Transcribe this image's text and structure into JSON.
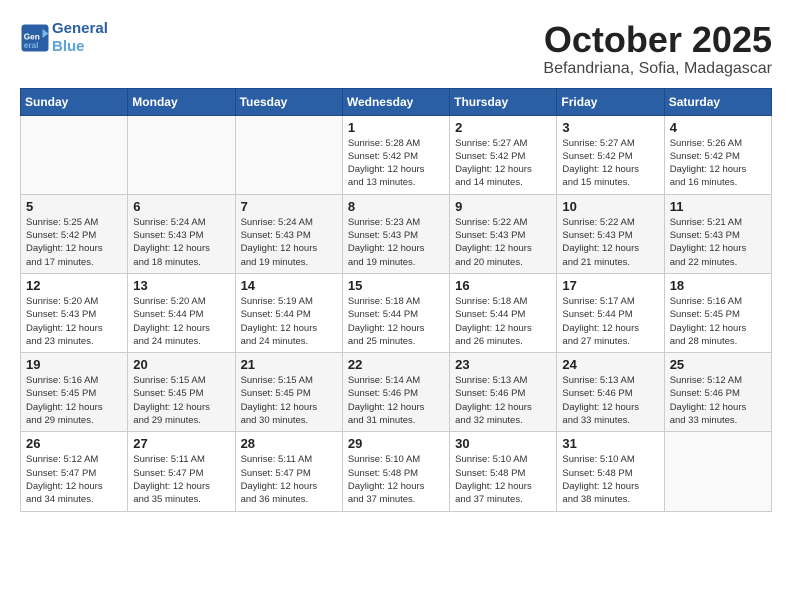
{
  "logo": {
    "text1": "General",
    "text2": "Blue"
  },
  "title": "October 2025",
  "subtitle": "Befandriana, Sofia, Madagascar",
  "days_of_week": [
    "Sunday",
    "Monday",
    "Tuesday",
    "Wednesday",
    "Thursday",
    "Friday",
    "Saturday"
  ],
  "weeks": [
    [
      {
        "day": "",
        "info": ""
      },
      {
        "day": "",
        "info": ""
      },
      {
        "day": "",
        "info": ""
      },
      {
        "day": "1",
        "info": "Sunrise: 5:28 AM\nSunset: 5:42 PM\nDaylight: 12 hours\nand 13 minutes."
      },
      {
        "day": "2",
        "info": "Sunrise: 5:27 AM\nSunset: 5:42 PM\nDaylight: 12 hours\nand 14 minutes."
      },
      {
        "day": "3",
        "info": "Sunrise: 5:27 AM\nSunset: 5:42 PM\nDaylight: 12 hours\nand 15 minutes."
      },
      {
        "day": "4",
        "info": "Sunrise: 5:26 AM\nSunset: 5:42 PM\nDaylight: 12 hours\nand 16 minutes."
      }
    ],
    [
      {
        "day": "5",
        "info": "Sunrise: 5:25 AM\nSunset: 5:42 PM\nDaylight: 12 hours\nand 17 minutes."
      },
      {
        "day": "6",
        "info": "Sunrise: 5:24 AM\nSunset: 5:43 PM\nDaylight: 12 hours\nand 18 minutes."
      },
      {
        "day": "7",
        "info": "Sunrise: 5:24 AM\nSunset: 5:43 PM\nDaylight: 12 hours\nand 19 minutes."
      },
      {
        "day": "8",
        "info": "Sunrise: 5:23 AM\nSunset: 5:43 PM\nDaylight: 12 hours\nand 19 minutes."
      },
      {
        "day": "9",
        "info": "Sunrise: 5:22 AM\nSunset: 5:43 PM\nDaylight: 12 hours\nand 20 minutes."
      },
      {
        "day": "10",
        "info": "Sunrise: 5:22 AM\nSunset: 5:43 PM\nDaylight: 12 hours\nand 21 minutes."
      },
      {
        "day": "11",
        "info": "Sunrise: 5:21 AM\nSunset: 5:43 PM\nDaylight: 12 hours\nand 22 minutes."
      }
    ],
    [
      {
        "day": "12",
        "info": "Sunrise: 5:20 AM\nSunset: 5:43 PM\nDaylight: 12 hours\nand 23 minutes."
      },
      {
        "day": "13",
        "info": "Sunrise: 5:20 AM\nSunset: 5:44 PM\nDaylight: 12 hours\nand 24 minutes."
      },
      {
        "day": "14",
        "info": "Sunrise: 5:19 AM\nSunset: 5:44 PM\nDaylight: 12 hours\nand 24 minutes."
      },
      {
        "day": "15",
        "info": "Sunrise: 5:18 AM\nSunset: 5:44 PM\nDaylight: 12 hours\nand 25 minutes."
      },
      {
        "day": "16",
        "info": "Sunrise: 5:18 AM\nSunset: 5:44 PM\nDaylight: 12 hours\nand 26 minutes."
      },
      {
        "day": "17",
        "info": "Sunrise: 5:17 AM\nSunset: 5:44 PM\nDaylight: 12 hours\nand 27 minutes."
      },
      {
        "day": "18",
        "info": "Sunrise: 5:16 AM\nSunset: 5:45 PM\nDaylight: 12 hours\nand 28 minutes."
      }
    ],
    [
      {
        "day": "19",
        "info": "Sunrise: 5:16 AM\nSunset: 5:45 PM\nDaylight: 12 hours\nand 29 minutes."
      },
      {
        "day": "20",
        "info": "Sunrise: 5:15 AM\nSunset: 5:45 PM\nDaylight: 12 hours\nand 29 minutes."
      },
      {
        "day": "21",
        "info": "Sunrise: 5:15 AM\nSunset: 5:45 PM\nDaylight: 12 hours\nand 30 minutes."
      },
      {
        "day": "22",
        "info": "Sunrise: 5:14 AM\nSunset: 5:46 PM\nDaylight: 12 hours\nand 31 minutes."
      },
      {
        "day": "23",
        "info": "Sunrise: 5:13 AM\nSunset: 5:46 PM\nDaylight: 12 hours\nand 32 minutes."
      },
      {
        "day": "24",
        "info": "Sunrise: 5:13 AM\nSunset: 5:46 PM\nDaylight: 12 hours\nand 33 minutes."
      },
      {
        "day": "25",
        "info": "Sunrise: 5:12 AM\nSunset: 5:46 PM\nDaylight: 12 hours\nand 33 minutes."
      }
    ],
    [
      {
        "day": "26",
        "info": "Sunrise: 5:12 AM\nSunset: 5:47 PM\nDaylight: 12 hours\nand 34 minutes."
      },
      {
        "day": "27",
        "info": "Sunrise: 5:11 AM\nSunset: 5:47 PM\nDaylight: 12 hours\nand 35 minutes."
      },
      {
        "day": "28",
        "info": "Sunrise: 5:11 AM\nSunset: 5:47 PM\nDaylight: 12 hours\nand 36 minutes."
      },
      {
        "day": "29",
        "info": "Sunrise: 5:10 AM\nSunset: 5:48 PM\nDaylight: 12 hours\nand 37 minutes."
      },
      {
        "day": "30",
        "info": "Sunrise: 5:10 AM\nSunset: 5:48 PM\nDaylight: 12 hours\nand 37 minutes."
      },
      {
        "day": "31",
        "info": "Sunrise: 5:10 AM\nSunset: 5:48 PM\nDaylight: 12 hours\nand 38 minutes."
      },
      {
        "day": "",
        "info": ""
      }
    ]
  ]
}
